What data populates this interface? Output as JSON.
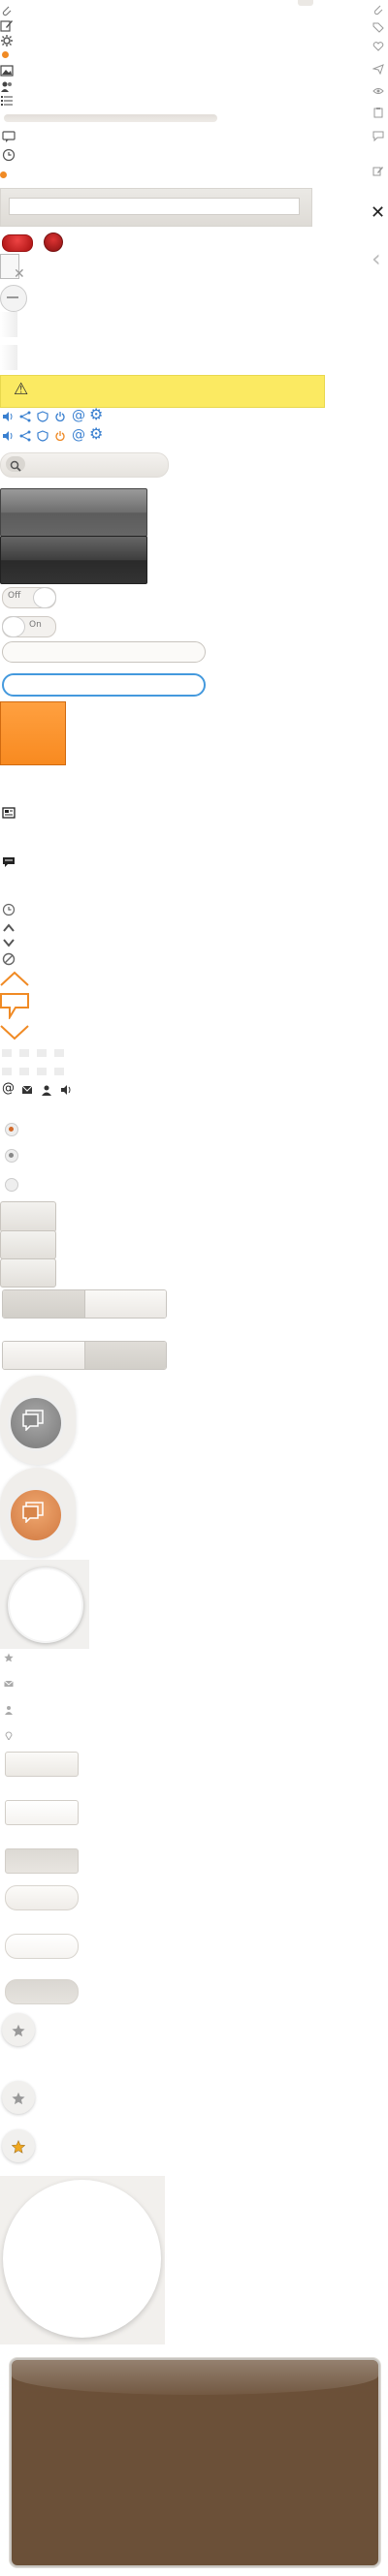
{
  "icons_top": [
    "paperclip-icon",
    "edit-icon",
    "gear-icon",
    "notification-dot-icon",
    "image-icon",
    "users-icon",
    "list-icon"
  ],
  "icons_right": [
    "paperclip-icon",
    "tag-icon",
    "heart-icon",
    "send-icon",
    "eye-icon",
    "clipboard-icon",
    "comment-icon",
    "edit-icon"
  ],
  "close_glyph": "✕",
  "back_glyph": "‹",
  "warning_glyph": "⚠",
  "search_glyph": "🔍",
  "at_glyph": "@",
  "gear_glyph": "⚙",
  "toggle_labels": {
    "toggle_off": "Off",
    "toggle_on": "On"
  },
  "input_placeholders": {
    "search": "",
    "text_field": "",
    "focused_field": ""
  },
  "colors": {
    "accent_orange": "#ff9833",
    "warning_yellow": "#fbea62",
    "toolbar_dark": "#3d3d3d",
    "focus_blue": "#4499dd",
    "brown_panel": "#6b5038",
    "red_button": "#cc2222",
    "icon_blue": "#3399dd"
  }
}
